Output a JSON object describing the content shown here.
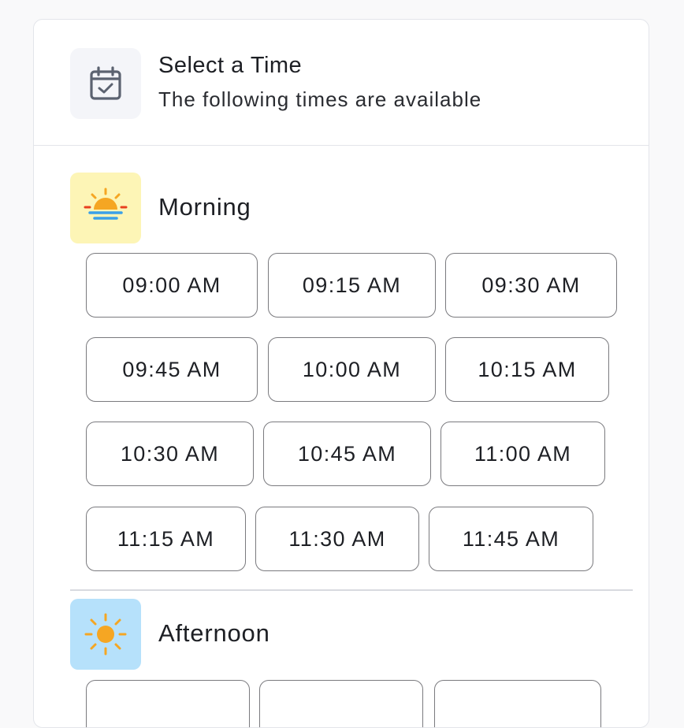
{
  "header": {
    "title": "Select a Time",
    "subtitle": "The following times are available",
    "icon": "calendar-check-icon"
  },
  "morning": {
    "label": "Morning",
    "icon": "sunrise-icon",
    "icon_bg": "#fdf5b6",
    "slots": [
      "09:00 AM",
      "09:15 AM",
      "09:30 AM",
      "09:45 AM",
      "10:00 AM",
      "10:15 AM",
      "10:30 AM",
      "10:45 AM",
      "11:00 AM",
      "11:15 AM",
      "11:30 AM",
      "11:45 AM"
    ]
  },
  "afternoon": {
    "label": "Afternoon",
    "icon": "sun-icon",
    "icon_bg": "#b6e1fb"
  },
  "colors": {
    "sun_orange": "#f5a623",
    "water_blue": "#3aa0e8",
    "icon_gray": "#5b6270"
  }
}
